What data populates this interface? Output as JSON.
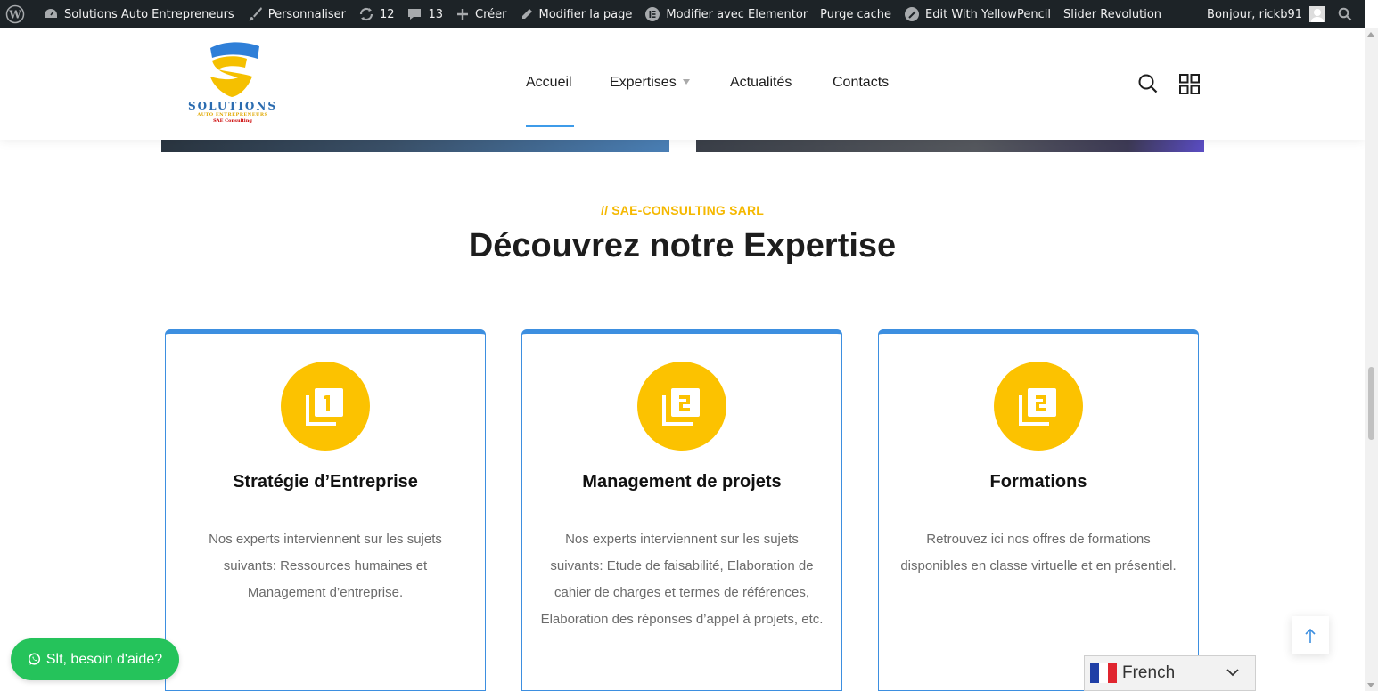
{
  "admin_bar": {
    "site_name": "Solutions Auto Entrepreneurs",
    "customize": "Personnaliser",
    "updates_count": "12",
    "comments_count": "13",
    "new": "Créer",
    "edit_page": "Modifier la page",
    "elementor": "Modifier avec Elementor",
    "purge_cache": "Purge cache",
    "yellowpencil": "Edit With YellowPencil",
    "slider": "Slider Revolution",
    "greeting": "Bonjour, rickb91"
  },
  "logo": {
    "line1": "SOLUTIONS",
    "line2": "AUTO ENTREPRENEURS",
    "line3": "SAE Consulting"
  },
  "nav": {
    "items": [
      "Accueil",
      "Expertises",
      "Actualités",
      "Contacts"
    ],
    "active": "Accueil"
  },
  "section": {
    "eyebrow": "// SAE-CONSULTING SARL",
    "title": "Découvrez notre Expertise"
  },
  "cards": [
    {
      "number": "1",
      "title": "Stratégie d’Entreprise",
      "text": "Nos experts interviennent sur les sujets suivants: Ressources humaines et Management d’entreprise."
    },
    {
      "number": "2",
      "title": "Management de projets",
      "text": "Nos experts interviennent sur les sujets suivants: Etude de faisabilité, Elaboration de cahier de charges et termes de références, Elaboration des réponses d’appel à projets, etc."
    },
    {
      "number": "2",
      "title": "Formations",
      "text": "Retrouvez ici nos offres de formations disponibles en classe virtuelle et en présentiel."
    }
  ],
  "whatsapp": {
    "label": "Slt, besoin d'aide?"
  },
  "language": {
    "selected": "French"
  },
  "colors": {
    "accent_yellow": "#fcc200",
    "accent_blue": "#3d8fe0",
    "whatsapp_green": "#25c35b",
    "admin_bar": "#1d2327"
  }
}
